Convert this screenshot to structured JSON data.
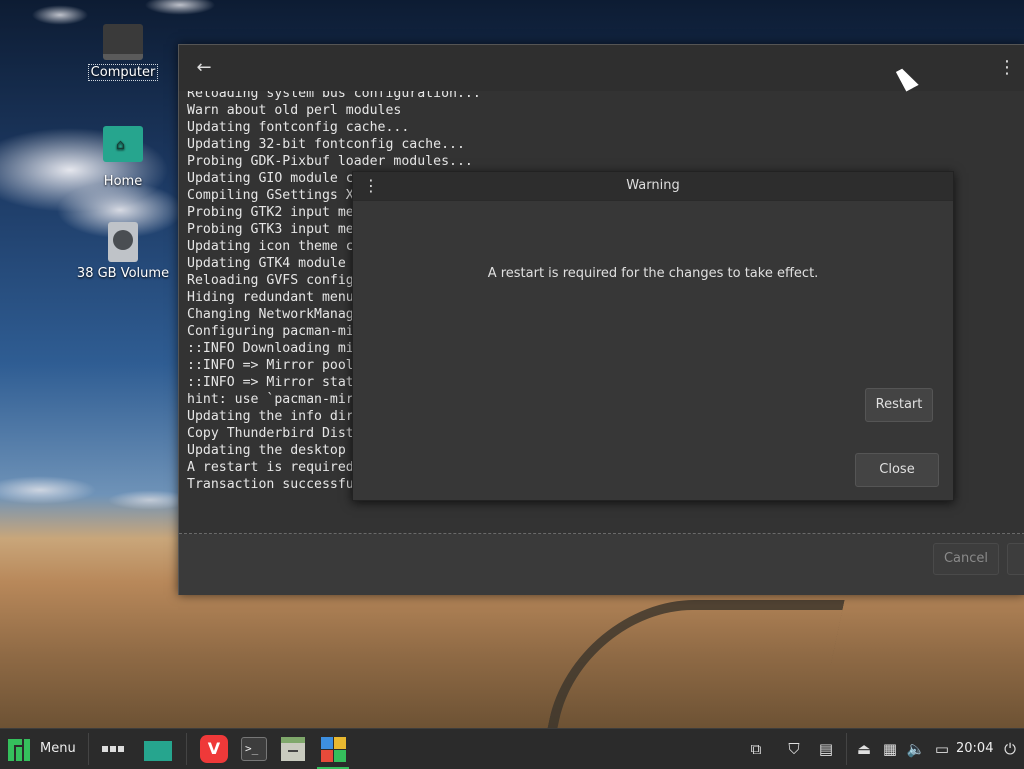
{
  "desktop": {
    "icons": [
      {
        "label": "Computer"
      },
      {
        "label": "Home"
      },
      {
        "label": "38 GB Volume"
      }
    ]
  },
  "main_window": {
    "terminal_lines": [
      "Reloading system bus configuration...",
      "Warn about old perl modules",
      "Updating fontconfig cache...",
      "Updating 32-bit fontconfig cache...",
      "Probing GDK-Pixbuf loader modules...",
      "Updating GIO module c",
      "Compiling GSettings X",
      "Probing GTK2 input me",
      "Probing GTK3 input me",
      "Updating icon theme c",
      "Updating GTK4 module",
      "Reloading GVFS config",
      "Hiding redundant menu",
      "Changing NetworkManag",
      "Configuring pacman-mi",
      "::INFO Downloading mi",
      "::INFO => Mirror pool",
      "::INFO => Mirror stat",
      "hint: use `pacman-mir",
      "Updating the info dir",
      "Copy Thunderbird Dist",
      "Updating the desktop",
      "A restart is required",
      "Transaction successfu"
    ],
    "cancel_label": "Cancel"
  },
  "dialog": {
    "title": "Warning",
    "message": "A restart is required for the changes to take effect.",
    "restart_label": "Restart",
    "close_label": "Close"
  },
  "taskbar": {
    "menu_label": "Menu",
    "clock": "20:04"
  },
  "colors": {
    "accent": "#35bf5c",
    "home_folder": "#26a58e",
    "vivaldi": "#ef3939"
  }
}
